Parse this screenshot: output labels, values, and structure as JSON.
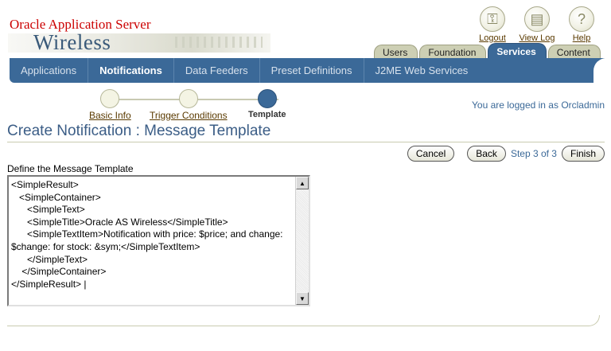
{
  "brand": {
    "line1": "Oracle Application Server",
    "line2": "Wireless"
  },
  "global_links": [
    {
      "label": "Logout",
      "icon": "key-icon",
      "glyph": "⚿"
    },
    {
      "label": "View Log",
      "icon": "log-icon",
      "glyph": "▤"
    },
    {
      "label": "Help",
      "icon": "help-icon",
      "glyph": "?"
    }
  ],
  "top_tabs": [
    {
      "label": "Users",
      "active": false
    },
    {
      "label": "Foundation",
      "active": false
    },
    {
      "label": "Services",
      "active": true
    },
    {
      "label": "Content",
      "active": false
    }
  ],
  "subnav": [
    {
      "label": "Applications",
      "active": false
    },
    {
      "label": "Notifications",
      "active": true
    },
    {
      "label": "Data Feeders",
      "active": false
    },
    {
      "label": "Preset Definitions",
      "active": false
    },
    {
      "label": "J2ME Web Services",
      "active": false
    }
  ],
  "train": {
    "steps": [
      {
        "label": "Basic Info",
        "current": false
      },
      {
        "label": "Trigger Conditions",
        "current": false
      },
      {
        "label": "Template",
        "current": true
      }
    ]
  },
  "logged_in": "You are logged in as Orcladmin",
  "page_title": "Create Notification : Message Template",
  "actions": {
    "cancel": "Cancel",
    "back": "Back",
    "step_info": "Step 3 of 3",
    "finish": "Finish"
  },
  "template_field": {
    "label": "Define the Message Template",
    "value": "<SimpleResult>\n   <SimpleContainer>\n      <SimpleText>\n      <SimpleTitle>Oracle AS Wireless</SimpleTitle>\n      <SimpleTextItem>Notification with price: $price; and change: $change: for stock: &sym;</SimpleTextItem>\n      </SimpleText>\n    </SimpleContainer>\n</SimpleResult> |"
  },
  "colors": {
    "accent": "#3b6998",
    "brand_red": "#cc0000",
    "tab_inactive": "#cdcfb4",
    "link_brown": "#5a3a00"
  }
}
